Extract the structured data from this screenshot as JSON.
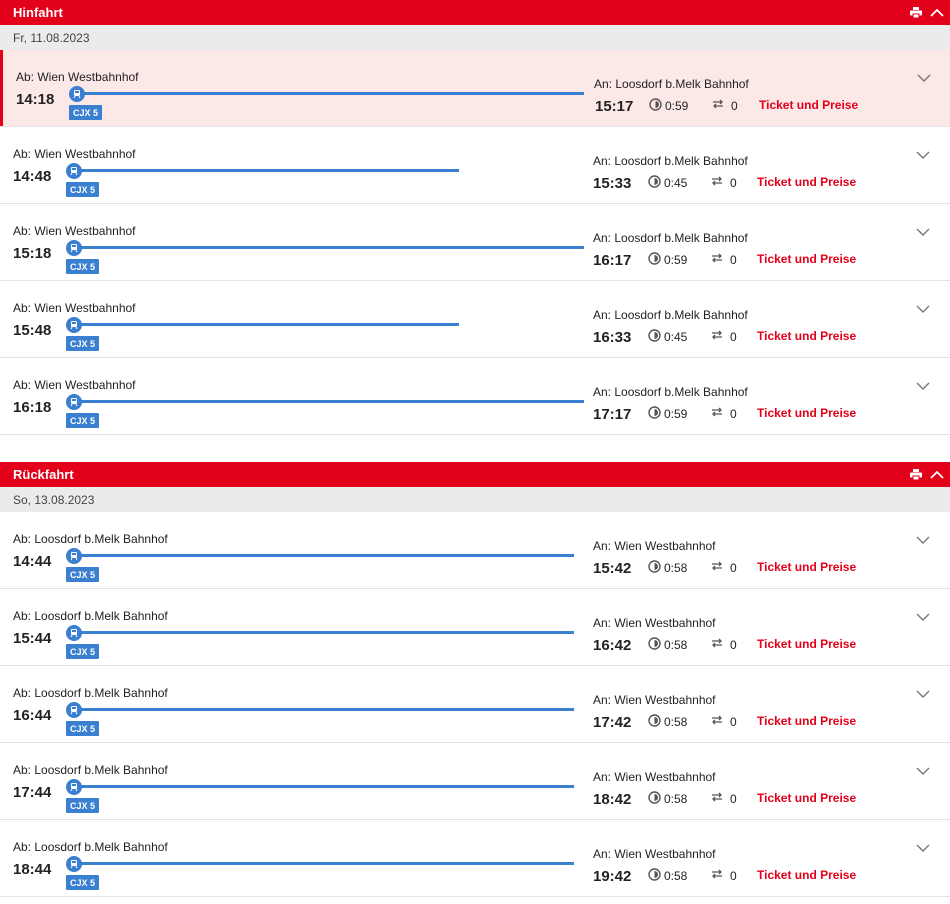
{
  "outbound": {
    "title": "Hinfahrt",
    "date": "Fr, 11.08.2023",
    "connections": [
      {
        "from": "Ab: Wien Westbahnhof",
        "dep": "14:18",
        "train": "CJX 5",
        "to": "An: Loosdorf b.Melk Bahnhof",
        "arr": "15:17",
        "duration": "0:59",
        "changes": "0",
        "ticket": "Ticket und Preise",
        "selected": true
      },
      {
        "from": "Ab: Wien Westbahnhof",
        "dep": "14:48",
        "train": "CJX 5",
        "to": "An: Loosdorf b.Melk Bahnhof",
        "arr": "15:33",
        "duration": "0:45",
        "changes": "0",
        "ticket": "Ticket und Preise"
      },
      {
        "from": "Ab: Wien Westbahnhof",
        "dep": "15:18",
        "train": "CJX 5",
        "to": "An: Loosdorf b.Melk Bahnhof",
        "arr": "16:17",
        "duration": "0:59",
        "changes": "0",
        "ticket": "Ticket und Preise"
      },
      {
        "from": "Ab: Wien Westbahnhof",
        "dep": "15:48",
        "train": "CJX 5",
        "to": "An: Loosdorf b.Melk Bahnhof",
        "arr": "16:33",
        "duration": "0:45",
        "changes": "0",
        "ticket": "Ticket und Preise"
      },
      {
        "from": "Ab: Wien Westbahnhof",
        "dep": "16:18",
        "train": "CJX 5",
        "to": "An: Loosdorf b.Melk Bahnhof",
        "arr": "17:17",
        "duration": "0:59",
        "changes": "0",
        "ticket": "Ticket und Preise"
      }
    ]
  },
  "return": {
    "title": "Rückfahrt",
    "date": "So, 13.08.2023",
    "connections": [
      {
        "from": "Ab: Loosdorf b.Melk Bahnhof",
        "dep": "14:44",
        "train": "CJX 5",
        "to": "An: Wien Westbahnhof",
        "arr": "15:42",
        "duration": "0:58",
        "changes": "0",
        "ticket": "Ticket und Preise"
      },
      {
        "from": "Ab: Loosdorf b.Melk Bahnhof",
        "dep": "15:44",
        "train": "CJX 5",
        "to": "An: Wien Westbahnhof",
        "arr": "16:42",
        "duration": "0:58",
        "changes": "0",
        "ticket": "Ticket und Preise"
      },
      {
        "from": "Ab: Loosdorf b.Melk Bahnhof",
        "dep": "16:44",
        "train": "CJX 5",
        "to": "An: Wien Westbahnhof",
        "arr": "17:42",
        "duration": "0:58",
        "changes": "0",
        "ticket": "Ticket und Preise"
      },
      {
        "from": "Ab: Loosdorf b.Melk Bahnhof",
        "dep": "17:44",
        "train": "CJX 5",
        "to": "An: Wien Westbahnhof",
        "arr": "18:42",
        "duration": "0:58",
        "changes": "0",
        "ticket": "Ticket und Preise"
      },
      {
        "from": "Ab: Loosdorf b.Melk Bahnhof",
        "dep": "18:44",
        "train": "CJX 5",
        "to": "An: Wien Westbahnhof",
        "arr": "19:42",
        "duration": "0:58",
        "changes": "0",
        "ticket": "Ticket und Preise"
      }
    ]
  },
  "icons": {
    "print": "print-icon",
    "collapse": "chevron-up-icon",
    "expand": "chevron-down-icon",
    "train": "train-icon",
    "duration": "clock-icon",
    "changes": "transfer-icon"
  },
  "colors": {
    "brand": "#e2001a",
    "train": "#3a7fd0",
    "selected_bg": "#fde8e8"
  }
}
